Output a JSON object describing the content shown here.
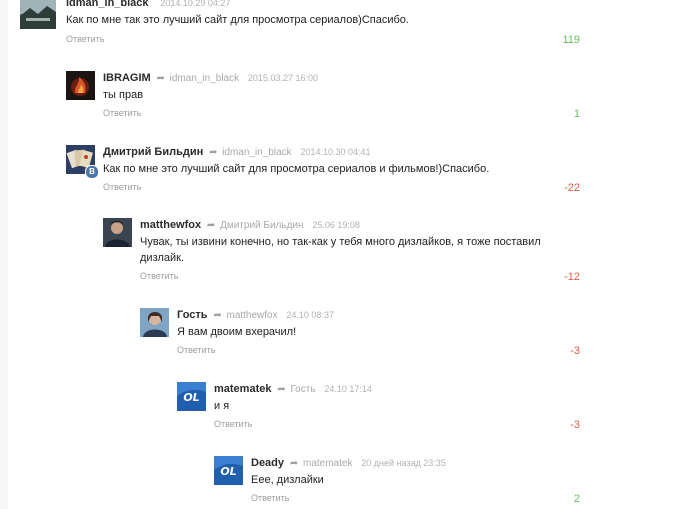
{
  "comments": [
    {
      "author": "idman_in_black",
      "reply_to": "",
      "date": "2014.10.29 04:27",
      "text": "Как по мне так это лучший сайт для просмотра сериалов)Спасибо.",
      "reply_label": "Ответить",
      "rating": "119",
      "avatar_icon": "landscape-avatar-icon"
    },
    {
      "author": "IBRAGIM",
      "reply_to": "idman_in_black",
      "date": "2015.03.27 16:00",
      "text": "ты прав",
      "reply_label": "Ответить",
      "rating": "1",
      "avatar_icon": "fire-avatar-icon"
    },
    {
      "author": "Дмитрий Бильдин",
      "reply_to": "idman_in_black",
      "date": "2014.10.30 04:41",
      "text": "Как по мне это лучший сайт для просмотра сериалов и фильмов!)Спасибо.",
      "reply_label": "Ответить",
      "rating": "-22",
      "avatar_icon": "cards-avatar-icon",
      "badge": "B"
    },
    {
      "author": "matthewfox",
      "reply_to": "Дмитрий Бильдин",
      "date": "25.06 19:08",
      "text_line1": "Чувак, ты извини конечно, но так-как у тебя много дизлайков, я тоже поставил",
      "text_line2": "дизлайк.",
      "reply_label": "Ответить",
      "rating": "-12",
      "avatar_icon": "person-avatar-icon"
    },
    {
      "author": "Гость",
      "reply_to": "matthewfox",
      "date": "24.10 08:37",
      "text": "Я вам двоим вхерачил!",
      "reply_label": "Ответить",
      "rating": "-3",
      "avatar_icon": "guest-avatar-icon"
    },
    {
      "author": "matematek",
      "reply_to": "Гость",
      "date": "24.10 17:14",
      "text": "и я",
      "reply_label": "Ответить",
      "rating": "-3",
      "avatar_icon": "ol-logo-avatar-icon",
      "logo_text": "OL"
    },
    {
      "author": "Deady",
      "reply_to": "matematek",
      "date": "20 дней назад 23:35",
      "text": "Еее, дизлайки",
      "reply_label": "Ответить",
      "rating": "2",
      "avatar_icon": "ol-logo-avatar-icon",
      "logo_text": "OL"
    }
  ],
  "colors": {
    "positive": "#64c25a",
    "negative": "#e25a4a",
    "link": "#9d9d9d",
    "ol_logo": "#1f5fae"
  }
}
